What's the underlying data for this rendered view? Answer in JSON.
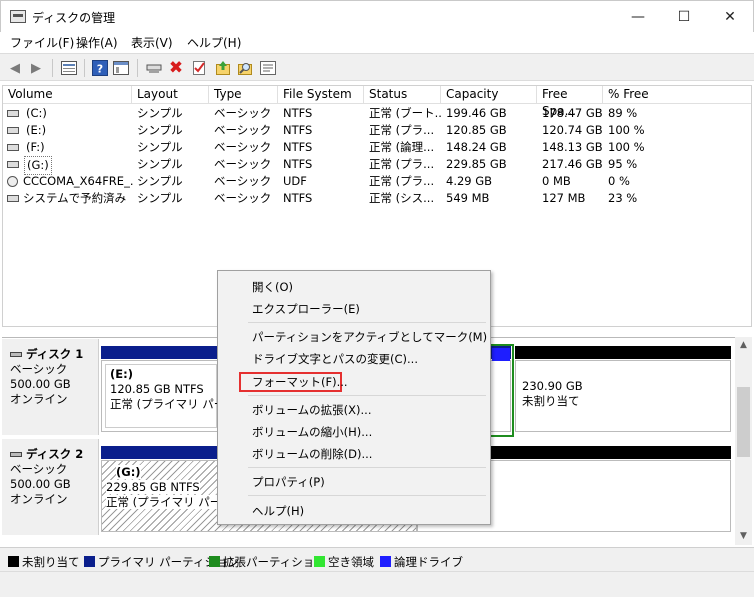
{
  "window": {
    "title": "ディスクの管理",
    "min": "—",
    "max": "☐",
    "close": "✕"
  },
  "menu": [
    "ファイル(F)",
    "操作(A)",
    "表示(V)",
    "ヘルプ(H)"
  ],
  "toolbar": {
    "icons": [
      "back-icon",
      "forward-icon",
      "properties-grid-icon",
      "help-icon",
      "console-icon",
      "connect-icon",
      "delete-icon",
      "checkmark-icon",
      "import-icon",
      "search-icon",
      "settings-icon"
    ]
  },
  "columns": [
    "Volume",
    "Layout",
    "Type",
    "File System",
    "Status",
    "Capacity",
    "Free Spa...",
    "% Free"
  ],
  "volumes": [
    {
      "volume": "(C:)",
      "layout": "シンプル",
      "type": "ベーシック",
      "fs": "NTFS",
      "status": "正常 (ブート...",
      "capacity": "199.46 GB",
      "free": "178.47 GB",
      "pct": "89 %",
      "icon": "drive-icon"
    },
    {
      "volume": "(E:)",
      "layout": "シンプル",
      "type": "ベーシック",
      "fs": "NTFS",
      "status": "正常 (プラ...",
      "capacity": "120.85 GB",
      "free": "120.74 GB",
      "pct": "100 %",
      "icon": "drive-icon"
    },
    {
      "volume": "(F:)",
      "layout": "シンプル",
      "type": "ベーシック",
      "fs": "NTFS",
      "status": "正常 (論理...",
      "capacity": "148.24 GB",
      "free": "148.13 GB",
      "pct": "100 %",
      "icon": "drive-icon"
    },
    {
      "volume": "(G:)",
      "layout": "シンプル",
      "type": "ベーシック",
      "fs": "NTFS",
      "status": "正常 (プラ...",
      "capacity": "229.85 GB",
      "free": "217.46 GB",
      "pct": "95 %",
      "icon": "drive-icon"
    },
    {
      "volume": "CCCOMA_X64FRE_...",
      "layout": "シンプル",
      "type": "ベーシック",
      "fs": "UDF",
      "status": "正常 (プラ...",
      "capacity": "4.29 GB",
      "free": "0 MB",
      "pct": "0 %",
      "icon": "cd-icon"
    },
    {
      "volume": "システムで予約済み",
      "layout": "シンプル",
      "type": "ベーシック",
      "fs": "NTFS",
      "status": "正常 (シス...",
      "capacity": "549 MB",
      "free": "127 MB",
      "pct": "23 %",
      "icon": "drive-icon"
    }
  ],
  "disks": [
    {
      "name": "ディスク 1",
      "type": "ベーシック",
      "size": "500.00 GB",
      "state": "オンライン",
      "partitions": [
        {
          "label": "(E:)",
          "size": "120.85 GB NTFS",
          "status": "正常 (プライマリ パーティ"
        },
        {
          "label": "",
          "size": "230.90 GB",
          "status": "未割り当て"
        }
      ]
    },
    {
      "name": "ディスク 2",
      "type": "ベーシック",
      "size": "500.00 GB",
      "state": "オンライン",
      "partitions": [
        {
          "label": "(G:)",
          "size": "229.85 GB NTFS",
          "status": "正常 (プライマリ パーティ"
        }
      ]
    }
  ],
  "legend": [
    {
      "label": "未割り当て",
      "color": "#000000"
    },
    {
      "label": "プライマリ パーティション",
      "color": "#0a1e8c"
    },
    {
      "label": "拡張パーティション",
      "color": "#1e8c1e"
    },
    {
      "label": "空き領域",
      "color": "#32e632"
    },
    {
      "label": "論理ドライブ",
      "color": "#1e1eff"
    }
  ],
  "context_menu": {
    "items": [
      "開く(O)",
      "エクスプローラー(E)",
      "パーティションをアクティブとしてマーク(M)",
      "ドライブ文字とパスの変更(C)...",
      "フォーマット(F)...",
      "ボリュームの拡張(X)...",
      "ボリュームの縮小(H)...",
      "ボリュームの削除(D)...",
      "プロパティ(P)",
      "ヘルプ(H)"
    ],
    "highlighted": "フォーマット(F)..."
  }
}
